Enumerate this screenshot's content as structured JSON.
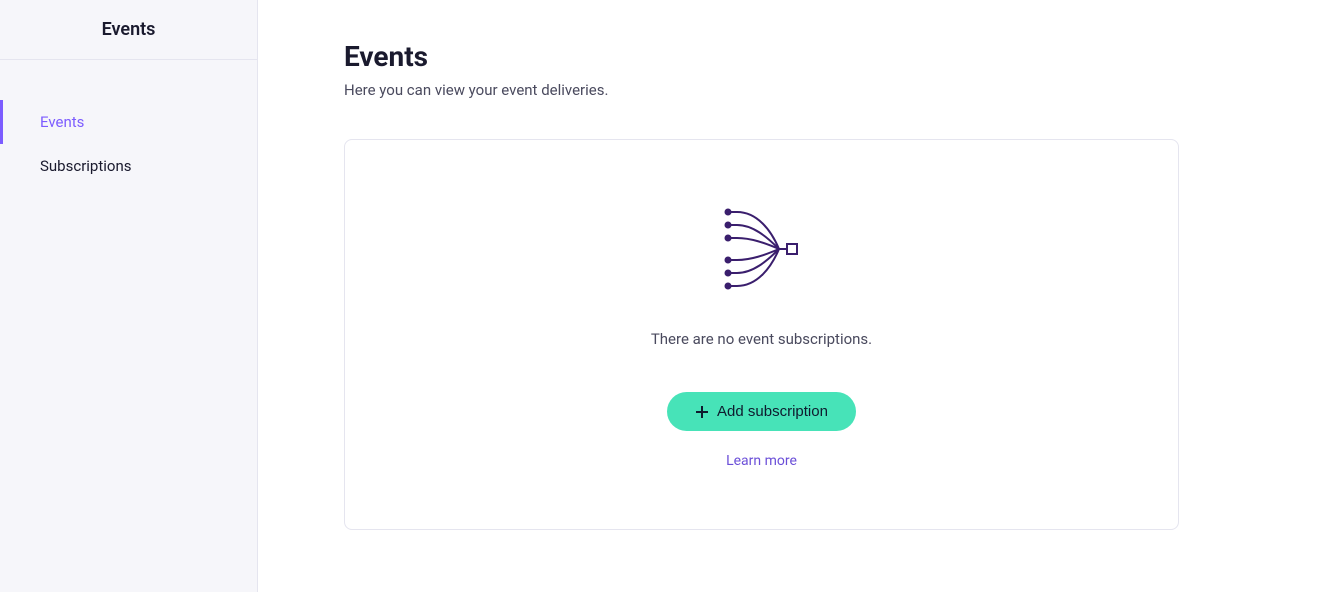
{
  "sidebar": {
    "title": "Events",
    "items": [
      {
        "label": "Events",
        "active": true
      },
      {
        "label": "Subscriptions",
        "active": false
      }
    ]
  },
  "main": {
    "title": "Events",
    "subtitle": "Here you can view your event deliveries.",
    "empty_message": "There are no event subscriptions.",
    "add_button_label": "Add subscription",
    "learn_more_label": "Learn more"
  }
}
